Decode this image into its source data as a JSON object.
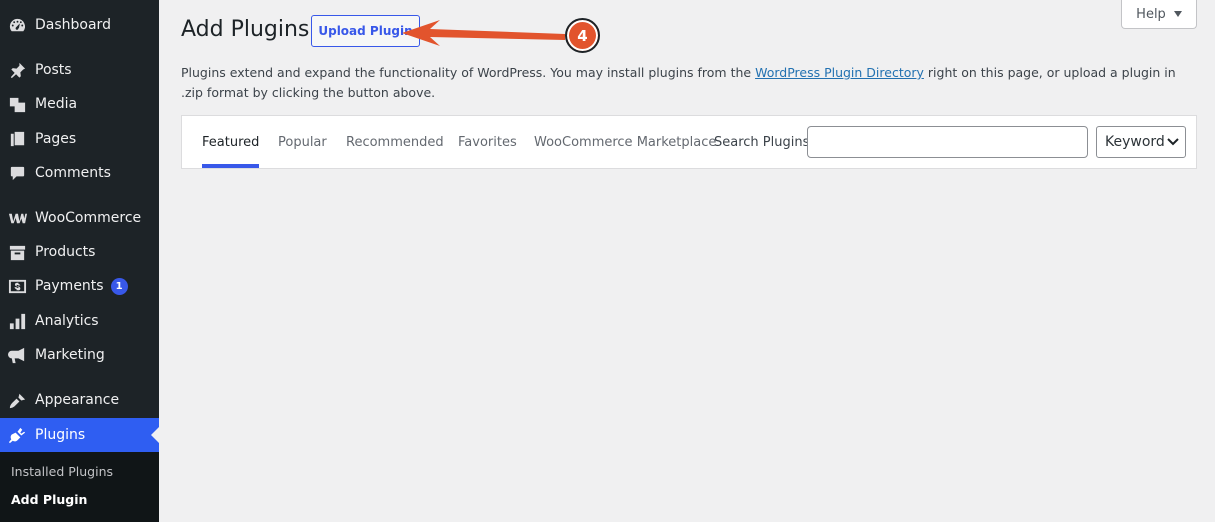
{
  "sidebar": {
    "items": [
      {
        "label": "Dashboard",
        "icon": "dashboard-icon"
      },
      {
        "label": "Posts",
        "icon": "pin-icon"
      },
      {
        "label": "Media",
        "icon": "media-icon"
      },
      {
        "label": "Pages",
        "icon": "pages-icon"
      },
      {
        "label": "Comments",
        "icon": "comment-icon"
      },
      {
        "label": "WooCommerce",
        "icon": "woocommerce-icon"
      },
      {
        "label": "Products",
        "icon": "archive-icon"
      },
      {
        "label": "Payments",
        "icon": "payments-icon",
        "badge": "1"
      },
      {
        "label": "Analytics",
        "icon": "bar-chart-icon"
      },
      {
        "label": "Marketing",
        "icon": "megaphone-icon"
      },
      {
        "label": "Appearance",
        "icon": "paintbrush-icon"
      },
      {
        "label": "Plugins",
        "icon": "plugin-icon"
      }
    ],
    "submenu": [
      "Installed Plugins",
      "Add Plugin"
    ]
  },
  "header": {
    "title": "Add Plugins",
    "upload_label": "Upload Plugin",
    "help_label": "Help"
  },
  "description": {
    "before": "Plugins extend and expand the functionality of WordPress. You may install plugins from the ",
    "link": "WordPress Plugin Directory",
    "after": " right on this page, or upload a plugin in .zip format by clicking the button above."
  },
  "filter": {
    "tabs": [
      "Featured",
      "Popular",
      "Recommended",
      "Favorites",
      "WooCommerce Marketplace"
    ],
    "search_label": "Search Plugins",
    "search_value": "",
    "search_type": "Keyword"
  },
  "annotation": {
    "step": "4",
    "color": "#e2542d"
  },
  "colors": {
    "sidebar": "#1d2327",
    "accent": "#3858e9",
    "background": "#f0f0f1"
  }
}
